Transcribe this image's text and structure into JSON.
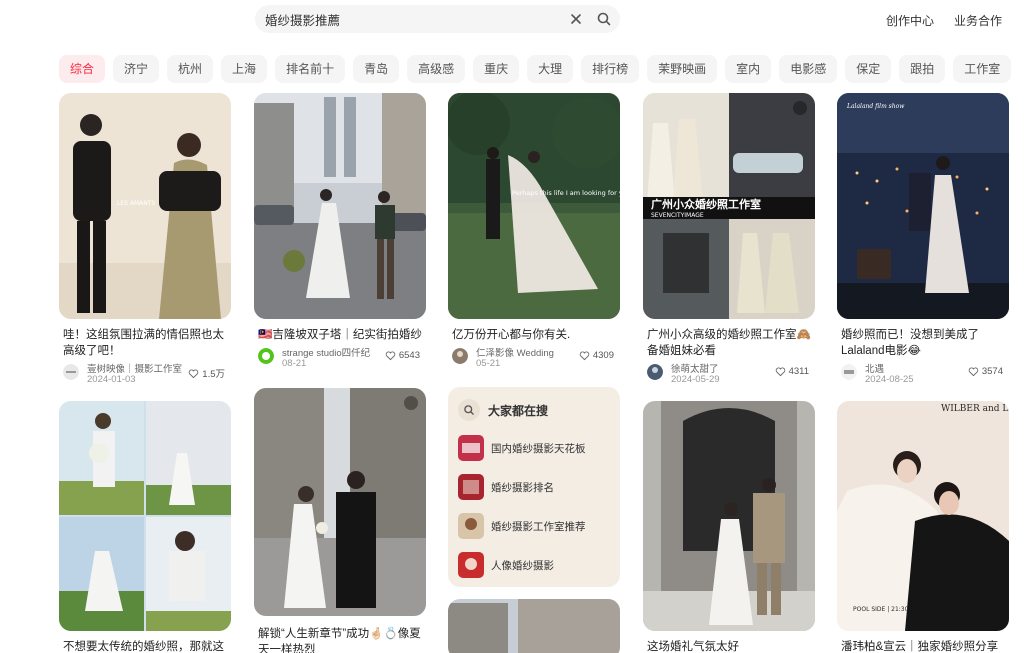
{
  "search": {
    "value": "婚纱摄影推薦"
  },
  "header": {
    "links": [
      "创作中心",
      "业务合作"
    ]
  },
  "tabs": [
    "综合",
    "济宁",
    "杭州",
    "上海",
    "排名前十",
    "青岛",
    "高级感",
    "重庆",
    "大理",
    "排行榜",
    "茉野映画",
    "室内",
    "电影感",
    "保定",
    "跟拍",
    "工作室"
  ],
  "cards": [
    {
      "title": "哇！这组氛围拉满的情侣照也太高级了吧！",
      "author": "壹树映像｜摄影工作室",
      "date": "2024-01-03",
      "likes": "1.5万",
      "image_text": "LES AMANTS"
    },
    {
      "title": "🇲🇾吉隆坡双子塔｜纪实街拍婚纱照",
      "author": "strange studio四仟纪",
      "date": "08-21",
      "likes": "6543"
    },
    {
      "title": "亿万份开心都与你有关.",
      "author": "仁泽影像 Wedding",
      "date": "05-21",
      "likes": "4309",
      "image_text": "Perhaps this life I am looking for you"
    },
    {
      "title": "广州小众高级的婚纱照工作室🙈备婚姐妹必看",
      "author": "徐萌太甜了",
      "date": "2024-05-29",
      "likes": "4311",
      "image_text": "广州小众婚纱照工作室",
      "image_subtext": "SEVENCITYIMAGE"
    },
    {
      "title": "婚纱照而已！没想到美成了Lalaland电影😂",
      "author": "北遇",
      "date": "2024-08-25",
      "likes": "3574",
      "image_text": "Lalaland film show"
    },
    {
      "title": "不想要太传统的婚纱照，那就这样"
    },
    {
      "title": "解锁“人生新章节”成功🤞🏻💍像夏天一样热烈"
    },
    {
      "title": "这场婚礼气氛太好"
    },
    {
      "title": "潘玮柏&宣云｜独家婚纱照分享",
      "image_text": "WILBER and LUNA",
      "image_subtext": "POOL SIDE | 21:30"
    }
  ],
  "trending": {
    "title": "大家都在搜",
    "items": [
      "国内婚纱摄影天花板",
      "婚纱摄影排名",
      "婚纱摄影工作室推荐",
      "人像婚纱摄影"
    ]
  },
  "colors": {
    "accent": "#ff2442",
    "tab_bg": "#f5f5f5",
    "trend_bg": "#f3ede4"
  }
}
